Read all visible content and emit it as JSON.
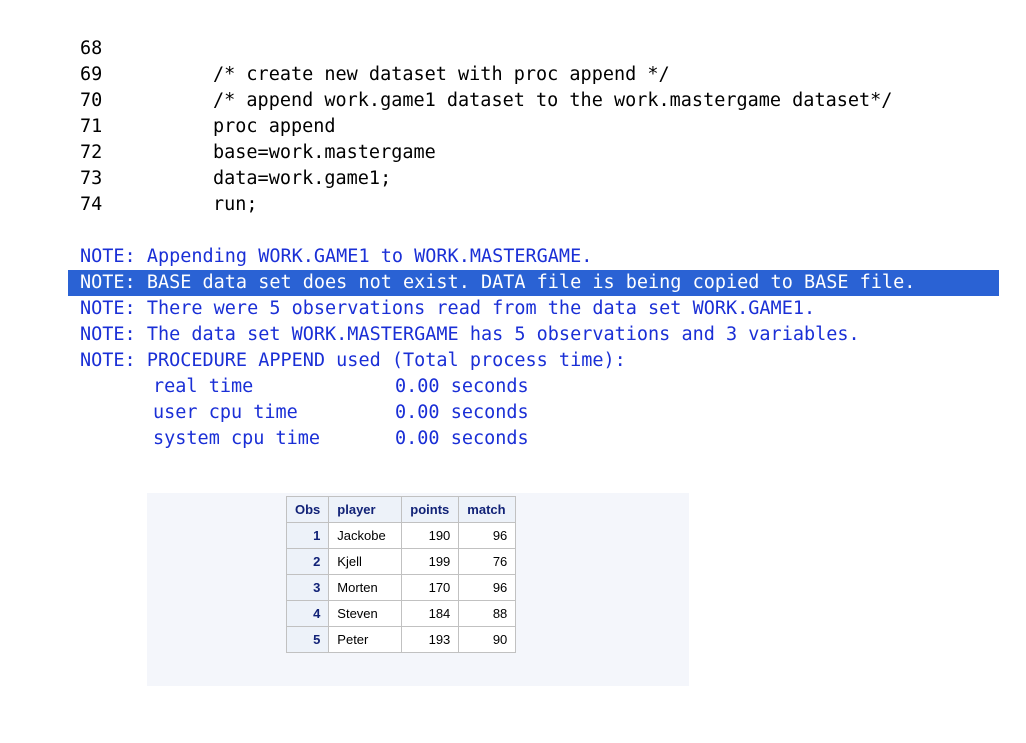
{
  "code_lines": [
    {
      "num": "68",
      "text": ""
    },
    {
      "num": "69",
      "text": "/* create new dataset with proc append */"
    },
    {
      "num": "70",
      "text": "/* append work.game1 dataset to the work.mastergame dataset*/"
    },
    {
      "num": "71",
      "text": "proc append"
    },
    {
      "num": "72",
      "text": "base=work.mastergame"
    },
    {
      "num": "73",
      "text": "data=work.game1;"
    },
    {
      "num": "74",
      "text": "run;"
    }
  ],
  "notes": [
    "NOTE: Appending WORK.GAME1 to WORK.MASTERGAME.",
    "NOTE: BASE data set does not exist. DATA file is being copied to BASE file.",
    "NOTE: There were 5 observations read from the data set WORK.GAME1.",
    "NOTE: The data set WORK.MASTERGAME has 5 observations and 3 variables.",
    "NOTE: PROCEDURE APPEND used (Total process time):"
  ],
  "timings": [
    {
      "label": "real time",
      "value": "0.00 seconds"
    },
    {
      "label": "user cpu time",
      "value": "0.00 seconds"
    },
    {
      "label": "system cpu time",
      "value": "0.00 seconds"
    }
  ],
  "table": {
    "headers": [
      "Obs",
      "player",
      "points",
      "match"
    ],
    "rows": [
      [
        "1",
        "Jackobe",
        "190",
        "96"
      ],
      [
        "2",
        "Kjell",
        "199",
        "76"
      ],
      [
        "3",
        "Morten",
        "170",
        "96"
      ],
      [
        "4",
        "Steven",
        "184",
        "88"
      ],
      [
        "5",
        "Peter",
        "193",
        "90"
      ]
    ]
  },
  "colors": {
    "note_text": "#1a2fd6",
    "highlight_bg": "#2a62d4",
    "highlight_text": "#ffffff",
    "header_bg": "#edf2f9",
    "header_text": "#112277"
  }
}
